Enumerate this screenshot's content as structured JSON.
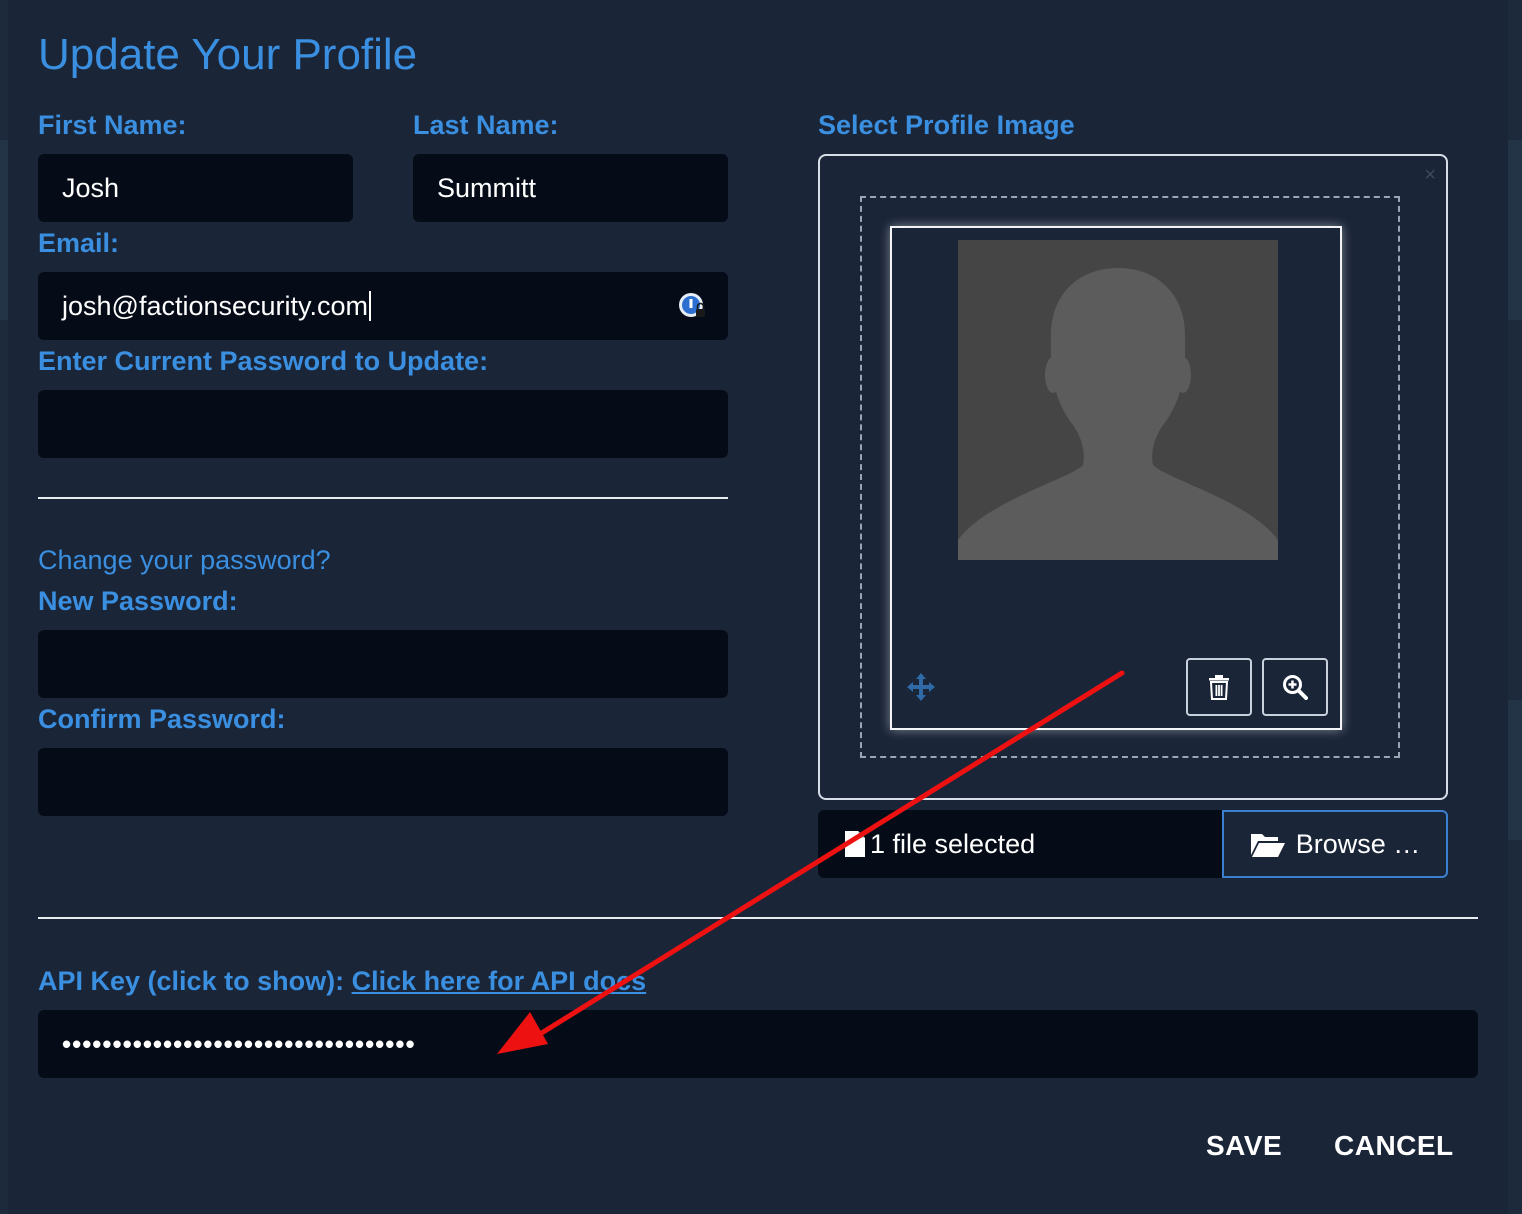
{
  "dialog": {
    "title": "Update Your Profile",
    "first_name": {
      "label": "First Name:",
      "value": "Josh"
    },
    "last_name": {
      "label": "Last Name:",
      "value": "Summitt"
    },
    "email": {
      "label": "Email:",
      "value": "josh@factionsecurity.com"
    },
    "current_password": {
      "label": "Enter Current Password to Update:",
      "value": ""
    },
    "change_password_prompt": "Change your password?",
    "new_password": {
      "label": "New Password:",
      "value": ""
    },
    "confirm_password": {
      "label": "Confirm Password:",
      "value": ""
    },
    "profile_image": {
      "label": "Select Profile Image",
      "file_status": "1 file selected",
      "browse_label": "Browse …",
      "close_glyph": "×"
    },
    "api_key": {
      "label": "API Key (click to show):",
      "docs_link": "Click here for API docs",
      "masked_value": "•••••••••••••••••••••••••••••••••••"
    },
    "save_label": "SAVE",
    "cancel_label": "CANCEL"
  },
  "colors": {
    "accent": "#3a8fe0",
    "input_bg": "#050c18",
    "modal_bg": "#1a2538",
    "annotation_arrow": "#ee1111"
  },
  "icons": [
    "password-manager-icon",
    "move-icon",
    "trash-icon",
    "zoom-in-icon",
    "file-icon",
    "folder-open-icon",
    "close-icon"
  ]
}
